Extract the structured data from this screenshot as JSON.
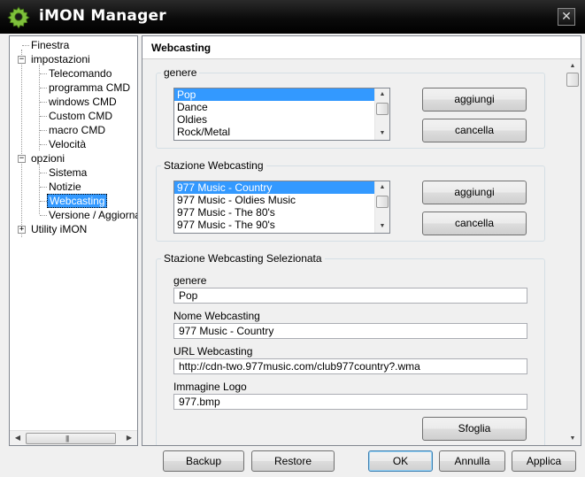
{
  "window": {
    "title": "iMON Manager",
    "close_glyph": "✕"
  },
  "tree": {
    "items": [
      {
        "label": "Finestra"
      },
      {
        "label": "impostazioni",
        "expander": "−"
      },
      {
        "label": "Telecomando"
      },
      {
        "label": "programma CMD"
      },
      {
        "label": "windows CMD"
      },
      {
        "label": "Custom CMD"
      },
      {
        "label": "macro CMD"
      },
      {
        "label": "Velocità"
      },
      {
        "label": "opzioni",
        "expander": "−"
      },
      {
        "label": "Sistema"
      },
      {
        "label": "Notizie"
      },
      {
        "label": "Webcasting"
      },
      {
        "label": "Versione / Aggiornamento"
      },
      {
        "label": "Utility iMON",
        "expander": "+"
      }
    ],
    "selected": "Webcasting",
    "scroll_left": "◀",
    "scroll_right": "▶",
    "scroll_grip": "|||"
  },
  "content": {
    "title": "Webcasting",
    "genre_group": {
      "label": "genere",
      "items": [
        "Pop",
        "Dance",
        "Oldies",
        "Rock/Metal"
      ],
      "selected": "Pop",
      "add_button": "aggiungi",
      "delete_button": "cancella"
    },
    "station_group": {
      "label": "Stazione Webcasting",
      "items": [
        "977 Music - Country",
        "977 Music - Oldies Music",
        "977 Music - The 80's",
        "977 Music - The 90's"
      ],
      "selected": "977 Music - Country",
      "add_button": "aggiungi",
      "delete_button": "cancella"
    },
    "selected_station_group": {
      "label": "Stazione Webcasting Selezionata",
      "genre_label": "genere",
      "genre_value": "Pop",
      "name_label": "Nome Webcasting",
      "name_value": "977 Music - Country",
      "url_label": "URL Webcasting",
      "url_value": "http://cdn-two.977music.com/club977country?.wma",
      "logo_label": "Immagine Logo",
      "logo_value": "977.bmp",
      "browse_button": "Sfoglia"
    },
    "scroll_up": "▲",
    "scroll_down": "▼"
  },
  "footer": {
    "backup": "Backup",
    "restore": "Restore",
    "ok": "OK",
    "cancel": "Annulla",
    "apply": "Applica"
  },
  "colors": {
    "selection": "#3399ff",
    "titlebar": "#000000",
    "accent_icon": "#7ec03b"
  },
  "icons": {
    "app": "gear-icon"
  }
}
